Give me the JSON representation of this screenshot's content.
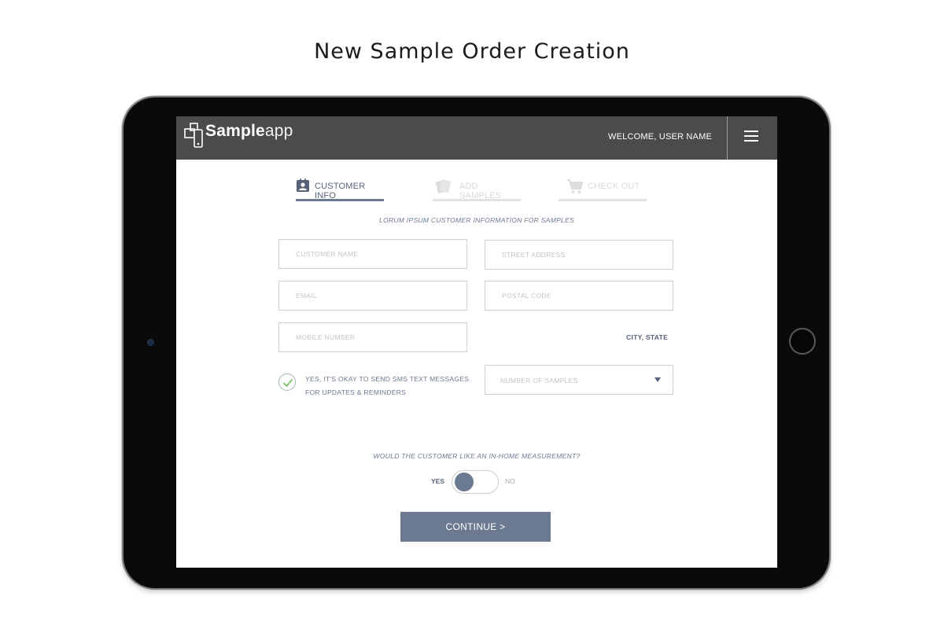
{
  "page": {
    "title": "New Sample Order Creation"
  },
  "header": {
    "logo_bold": "Sample",
    "logo_light": "app",
    "welcome": "WELCOME, USER NAME",
    "menu_icon": "hamburger-menu-icon"
  },
  "steps": [
    {
      "label": "CUSTOMER INFO",
      "icon": "contact-card-icon",
      "state": "active"
    },
    {
      "label": "ADD SAMPLES",
      "icon": "samples-icon",
      "state": "inactive"
    },
    {
      "label": "CHECK OUT",
      "icon": "cart-icon",
      "state": "inactive"
    }
  ],
  "form": {
    "subtitle": "LORUM IPSUM CUSTOMER INFORMATION FOR SAMPLES",
    "customer_name_placeholder": "CUSTOMER NAME",
    "street_address_placeholder": "STREET ADDRESS",
    "email_placeholder": "EMAIL",
    "postal_code_placeholder": "POSTAL CODE",
    "mobile_number_placeholder": "MOBILE NUMBER",
    "city_state": "CITY, STATE",
    "sms_consent_line1": "YES, IT'S OKAY TO SEND SMS TEXT MESSAGES",
    "sms_consent_line2": "FOR UPDATES & REMINDERS",
    "sms_consent_checked": true,
    "samples_select_placeholder": "NUMBER OF SAMPLES",
    "measurement_question": "WOULD THE CUSTOMER LIKE AN IN-HOME MEASUREMENT?",
    "toggle_yes": "YES",
    "toggle_no": "NO",
    "toggle_value": "YES",
    "continue_label": "CONTINUE >"
  },
  "colors": {
    "header_bg": "#4b4b4b",
    "accent": "#6b7a90",
    "check_green": "#7cc06a"
  }
}
